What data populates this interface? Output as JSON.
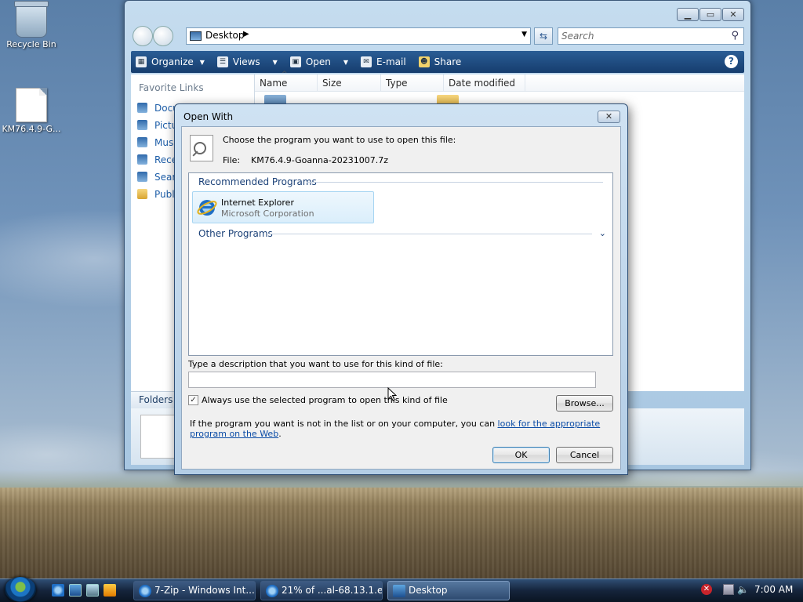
{
  "desktop": {
    "icons": [
      {
        "label": "Recycle Bin"
      },
      {
        "label": "KM76.4.9-G..."
      }
    ]
  },
  "explorer": {
    "address": "Desktop",
    "search_placeholder": "Search",
    "toolbar": [
      "Organize",
      "Views",
      "Open",
      "E-mail",
      "Share"
    ],
    "help_label": "?",
    "nav_header": "Favorite Links",
    "nav_links": [
      "Docu",
      "Pictu",
      "Musi",
      "Rece",
      "Searc",
      "Publi"
    ],
    "folders_label": "Folders",
    "columns": [
      "Name",
      "Size",
      "Type",
      "Date modified"
    ]
  },
  "dialog": {
    "title": "Open With",
    "choose_text": "Choose the program you want to use to open this file:",
    "file_label": "File:",
    "file_name": "KM76.4.9-Goanna-20231007.7z",
    "recommended_label": "Recommended Programs",
    "other_label": "Other Programs",
    "program": {
      "name": "Internet Explorer",
      "publisher": "Microsoft Corporation"
    },
    "desc_label": "Type a description that you want to use for this kind of file:",
    "desc_value": "",
    "always_use_label": "Always use the selected program to open this kind of file",
    "always_use_checked": true,
    "browse_label": "Browse...",
    "info_prefix": "If the program you want is not in the list or on your computer, you can ",
    "info_link": "look for the appropriate program on the Web",
    "info_suffix": ".",
    "ok_label": "OK",
    "cancel_label": "Cancel"
  },
  "taskbar": {
    "buttons": [
      {
        "label": "7-Zip - Windows Int..."
      },
      {
        "label": "21% of ...al-68.13.1.e..."
      },
      {
        "label": "Desktop"
      }
    ],
    "clock": "7:00 AM"
  }
}
